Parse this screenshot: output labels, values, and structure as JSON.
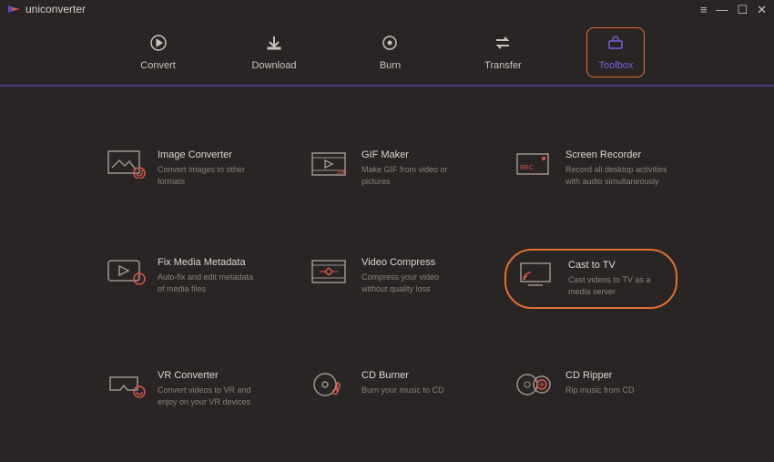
{
  "app": {
    "name": "uniconverter"
  },
  "tabs": [
    {
      "id": "convert",
      "label": "Convert"
    },
    {
      "id": "download",
      "label": "Download"
    },
    {
      "id": "burn",
      "label": "Burn"
    },
    {
      "id": "transfer",
      "label": "Transfer"
    },
    {
      "id": "toolbox",
      "label": "Toolbox"
    }
  ],
  "active_tab": "toolbox",
  "tools": [
    {
      "id": "image-converter",
      "title": "Image Converter",
      "desc": "Convert images to other formats"
    },
    {
      "id": "gif-maker",
      "title": "GIF Maker",
      "desc": "Make GIF from video or pictures"
    },
    {
      "id": "screen-recorder",
      "title": "Screen Recorder",
      "desc": "Record all desktop activities with audio simultaneously"
    },
    {
      "id": "fix-media-metadata",
      "title": "Fix Media Metadata",
      "desc": "Auto-fix and edit metadata of media files"
    },
    {
      "id": "video-compress",
      "title": "Video Compress",
      "desc": "Compress your video without quality loss"
    },
    {
      "id": "cast-to-tv",
      "title": "Cast to TV",
      "desc": "Cast videos to TV as a media server",
      "highlight": true
    },
    {
      "id": "vr-converter",
      "title": "VR Converter",
      "desc": "Convert videos to VR and enjoy on your VR devices"
    },
    {
      "id": "cd-burner",
      "title": "CD Burner",
      "desc": "Burn your music to CD"
    },
    {
      "id": "cd-ripper",
      "title": "CD Ripper",
      "desc": "Rip music from CD"
    }
  ]
}
